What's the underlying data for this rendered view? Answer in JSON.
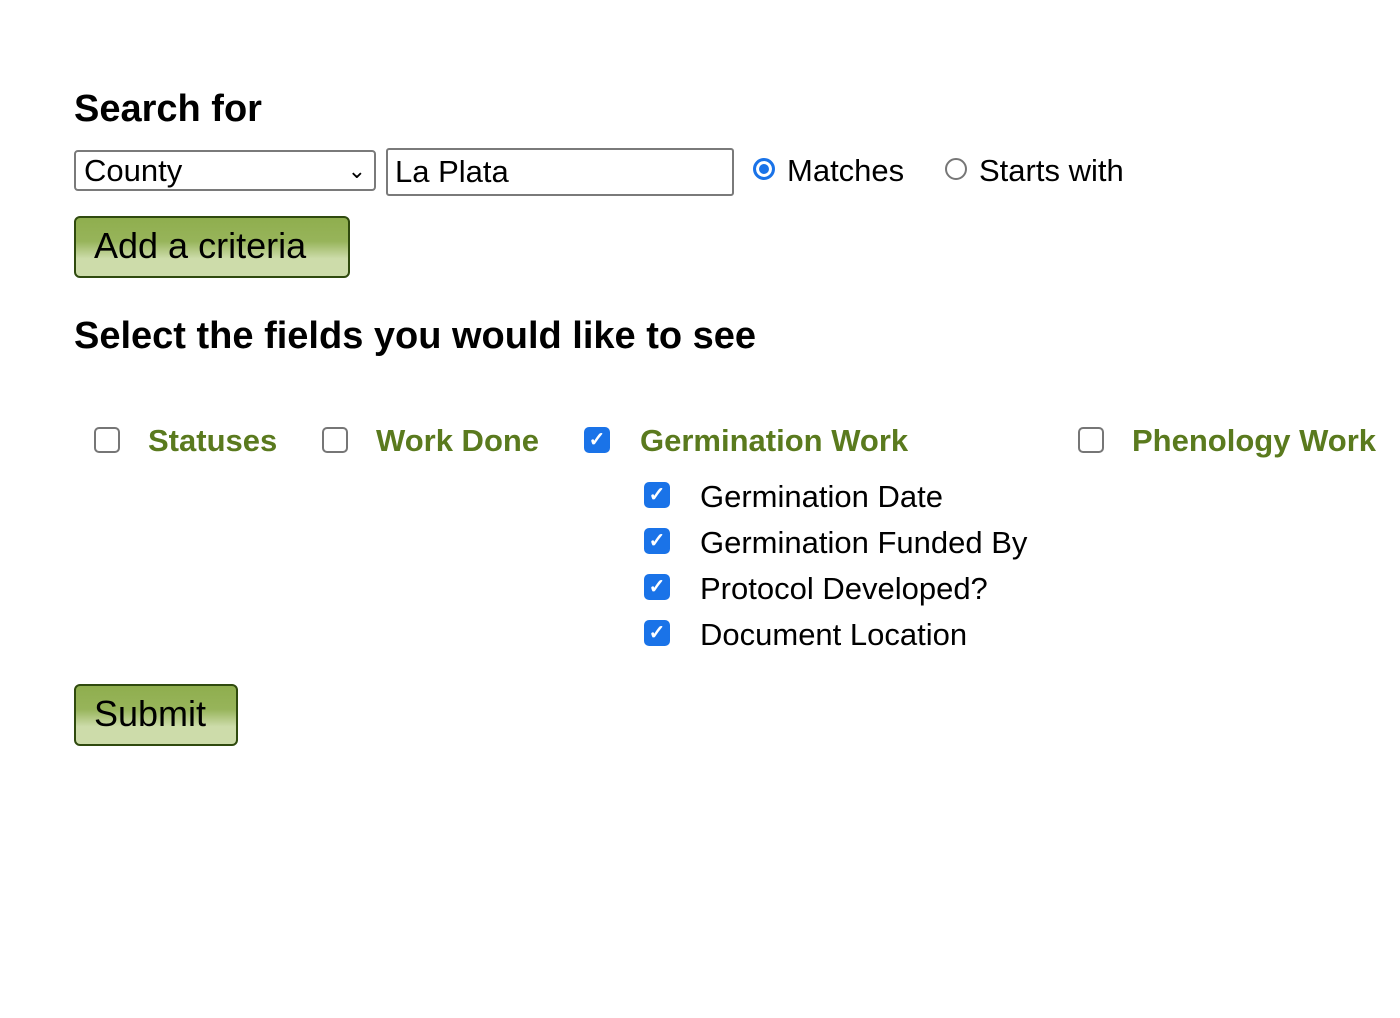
{
  "search": {
    "heading": "Search for",
    "field": "County",
    "value": "La Plata",
    "match_options": [
      {
        "label": "Matches",
        "selected": true
      },
      {
        "label": "Starts with",
        "selected": false
      }
    ],
    "add_label": "Add a criteria"
  },
  "fields": {
    "heading": "Select the fields you would like to see",
    "groups": [
      {
        "label": "Statuses",
        "checked": false
      },
      {
        "label": "Work Done",
        "checked": false
      },
      {
        "label": "Germination Work",
        "checked": true
      },
      {
        "label": "Phenology Work",
        "checked": false
      }
    ],
    "germination_fields": [
      {
        "label": "Germination Date",
        "checked": true
      },
      {
        "label": "Germination Funded By",
        "checked": true
      },
      {
        "label": "Protocol Developed?",
        "checked": true
      },
      {
        "label": "Document Location",
        "checked": true
      }
    ]
  },
  "submit_label": "Submit",
  "colors": {
    "group_label": "#5a7a1e",
    "accent": "#1a73e8",
    "button_border": "#2f4a0e"
  }
}
